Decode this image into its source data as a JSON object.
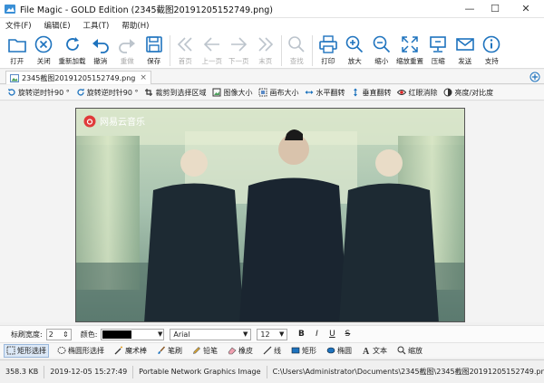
{
  "window": {
    "title": "File Magic - GOLD Edition (2345截图20191205152749.png)",
    "minimize": "—",
    "maximize": "☐",
    "close": "✕"
  },
  "menu": [
    "文件(F)",
    "编辑(E)",
    "工具(T)",
    "帮助(H)"
  ],
  "toolbar": {
    "open": "打开",
    "close": "关闭",
    "reload": "重新加载",
    "undo": "撤消",
    "redo": "重做",
    "save": "保存",
    "first": "首页",
    "prev": "上一页",
    "next": "下一页",
    "last": "末页",
    "find": "查找",
    "print": "打印",
    "zoom_in": "放大",
    "zoom_out": "缩小",
    "zoom_reset": "缩放重置",
    "compress": "压缩",
    "send": "发送",
    "support": "支持"
  },
  "tab": {
    "label": "2345截图20191205152749.png",
    "close": "×"
  },
  "image_tools": {
    "rotate_ccw": "旋转逆时针90 °",
    "rotate_cw": "旋转逆时针90 °",
    "crop_selection": "裁剪到选择区域",
    "image_size": "图像大小",
    "canvas_size": "画布大小",
    "flip_h": "水平翻转",
    "flip_v": "垂直翻转",
    "red_eye": "红眼消除",
    "brightness": "亮度/对比度"
  },
  "image": {
    "watermark": "网易云音乐"
  },
  "text_options": {
    "brush_width_label": "标刷宽度:",
    "brush_width": "2",
    "color_label": "颜色:",
    "font": "Arial",
    "font_size": "12",
    "bold": "B",
    "italic": "I",
    "underline": "U",
    "strike": "S"
  },
  "draw_tools": {
    "rect_select": "矩形选择",
    "ellipse_select": "椭圆形选择",
    "magic_wand": "魔术棒",
    "brush": "笔刷",
    "pencil": "铅笔",
    "eraser": "橡皮",
    "line": "线",
    "rectangle": "矩形",
    "ellipse": "椭圆",
    "text": "文本",
    "zoom": "缩放"
  },
  "status": {
    "size": "358.3 KB",
    "date": "2019-12-05 15:27:49",
    "type": "Portable Network Graphics Image",
    "path": "C:\\Users\\Administrator\\Documents\\2345截图\\2345截图20191205152749.png"
  },
  "colors": {
    "accent": "#1e73be",
    "canvas_bg": "#9bb6a5",
    "disabled": "#bcc4cc"
  }
}
